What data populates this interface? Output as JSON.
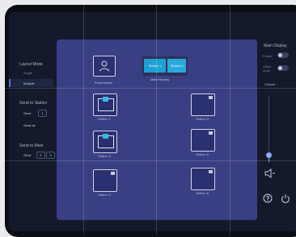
{
  "left_panel": {
    "layout_mode": {
      "title": "Layout Mode",
      "options": [
        "Single",
        "Multiple"
      ],
      "selected": "Multiple"
    },
    "send_to_station": {
      "title": "Send to Station",
      "rows": [
        {
          "label": "Send",
          "value": "1"
        },
        {
          "label": "Send all",
          "value": ""
        }
      ]
    },
    "send_to_main": {
      "title": "Send to Main",
      "label": "Send",
      "values": [
        "2",
        "3"
      ]
    }
  },
  "main": {
    "presenter_label": "Presentation",
    "popup": {
      "buttons": [
        "Station 1",
        "Station 2"
      ],
      "label": "Main Hockey"
    },
    "stations": [
      {
        "label": "Station 1",
        "active": true
      },
      {
        "label": "Station 2",
        "active": true
      },
      {
        "label": "Station 3",
        "active": false
      },
      {
        "label": "Station 4",
        "active": false
      },
      {
        "label": "Station 5",
        "active": false
      },
      {
        "label": "Station 6",
        "active": false
      }
    ]
  },
  "right_panel": {
    "title": "Main Display",
    "toggles": [
      {
        "label": "Power",
        "state": "off"
      },
      {
        "label": "Video mute",
        "state": "off"
      }
    ],
    "volume_label": "Volume",
    "volume_level": 0.1
  },
  "colors": {
    "accent": "#1f9fd2",
    "panel": "#3a3f83",
    "background": "#141a2c"
  }
}
